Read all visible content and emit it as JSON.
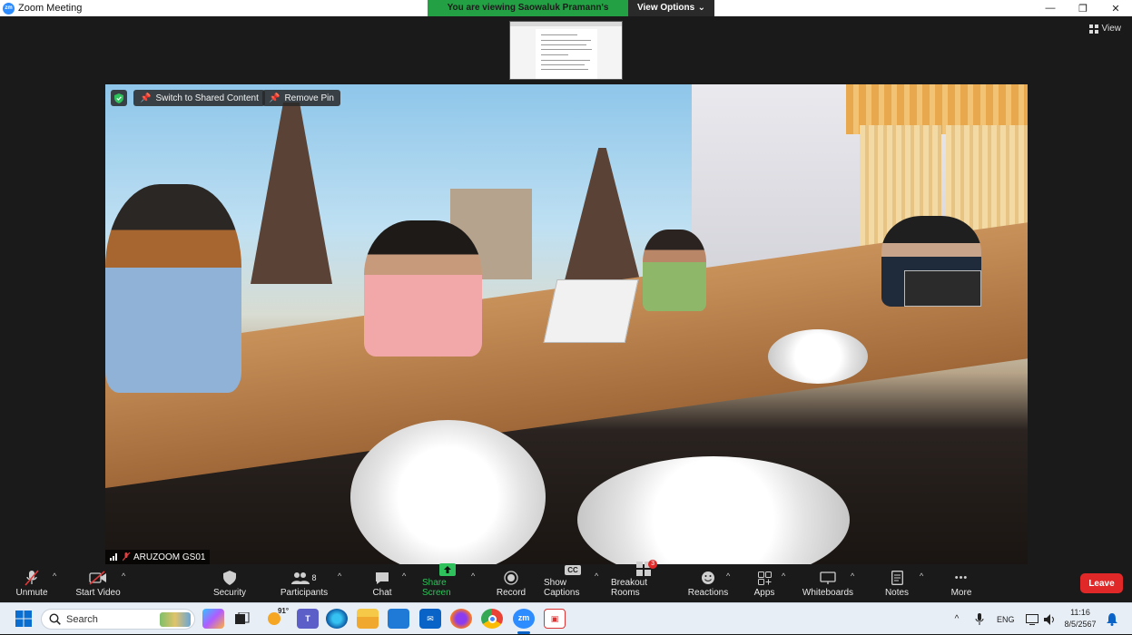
{
  "window": {
    "app_badge": "zm",
    "title": "Zoom Meeting",
    "minimize_glyph": "—",
    "restore_glyph": "❐",
    "close_glyph": "✕"
  },
  "share_banner": {
    "text": "You are viewing Saowaluk Pramann's screen",
    "view_options": "View Options",
    "chevron": "⌄"
  },
  "stage": {
    "view_label": "View"
  },
  "video": {
    "switch_label": "Switch to Shared Content",
    "remove_pin_label": "Remove Pin",
    "participant_name": "ARUZOOM GS01"
  },
  "toolbar": {
    "unmute": "Unmute",
    "start_video": "Start Video",
    "security": "Security",
    "participants": "Participants",
    "participants_count": "8",
    "chat": "Chat",
    "share_screen": "Share Screen",
    "record": "Record",
    "show_captions": "Show Captions",
    "cc_glyph": "CC",
    "breakout_rooms": "Breakout Rooms",
    "breakout_badge": "3",
    "reactions": "Reactions",
    "apps": "Apps",
    "whiteboards": "Whiteboards",
    "notes": "Notes",
    "more": "More",
    "more_glyph": "•••",
    "leave": "Leave",
    "caret": "^"
  },
  "taskbar": {
    "search_placeholder": "Search",
    "weather_temp": "91°",
    "zoom_app_label": "zm",
    "tray_chevron": "^",
    "language": "ENG",
    "time": "11:16",
    "date": "8/5/2567"
  },
  "colors": {
    "share_green": "#23a044",
    "leave_red": "#e02828",
    "zoom_blue": "#2d8cff",
    "toolbar_bg": "#1a1a1a",
    "taskbar_bg": "#e8eef5"
  }
}
